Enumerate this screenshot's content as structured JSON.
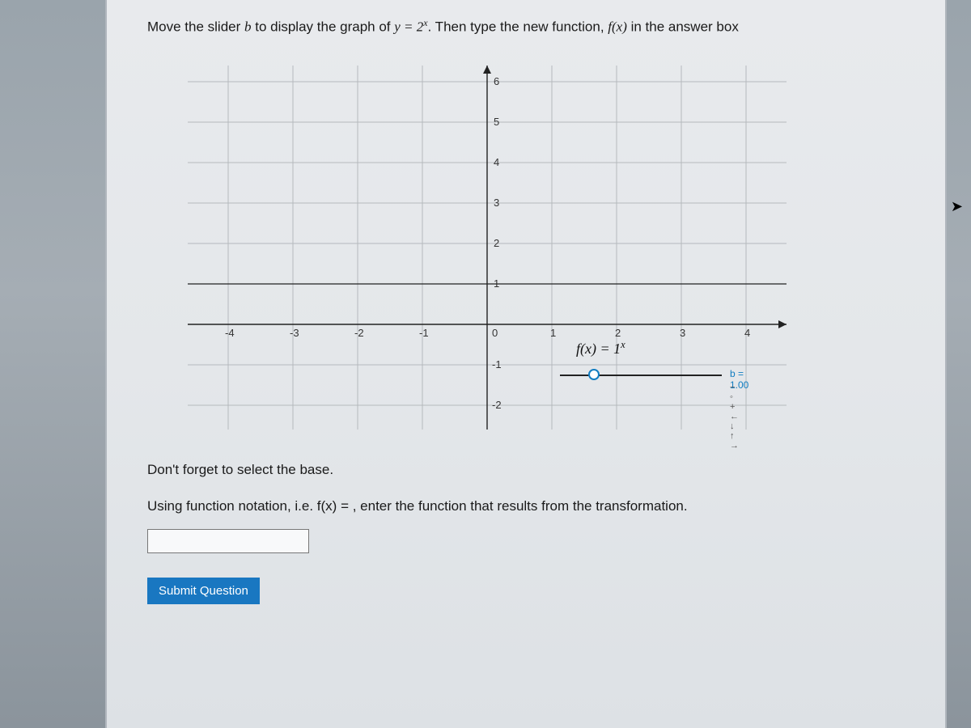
{
  "instruction": {
    "prefix": "Move the slider ",
    "b": "b",
    "mid": " to display the graph of ",
    "eq_y": "y = 2",
    "eq_exp": "x",
    "suffix1": ". Then type the new function, ",
    "fx": "f(x)",
    "suffix2": " in the answer box"
  },
  "graph": {
    "x_ticks": [
      "-4",
      "-3",
      "-2",
      "-1",
      "0",
      "1",
      "2",
      "3",
      "4"
    ],
    "y_ticks_pos": [
      "1",
      "2",
      "3",
      "4",
      "5",
      "6"
    ],
    "y_ticks_neg": [
      "-1",
      "-2"
    ],
    "fx_label_prefix": "f(x) = 1",
    "fx_label_exp": "x"
  },
  "slider": {
    "label": "b = 1.00",
    "buttons": "− ◦ + ← ↓ ↑ →"
  },
  "notes": {
    "line1": "Don't forget to select the base.",
    "line2": "Using function notation, i.e. f(x) = , enter the function that results from the transformation."
  },
  "answer": {
    "value": ""
  },
  "submit": {
    "label": "Submit Question"
  },
  "chart_data": {
    "type": "line",
    "title": "",
    "xlabel": "",
    "ylabel": "",
    "xlim": [
      -4.5,
      4.5
    ],
    "ylim": [
      -2,
      6.5
    ],
    "series": [
      {
        "name": "f(x) = 1^x",
        "x": [
          -4,
          -3,
          -2,
          -1,
          0,
          1,
          2,
          3,
          4
        ],
        "values": [
          1,
          1,
          1,
          1,
          1,
          1,
          1,
          1,
          1
        ]
      }
    ],
    "slider": {
      "name": "b",
      "value": 1.0,
      "range": null
    }
  }
}
